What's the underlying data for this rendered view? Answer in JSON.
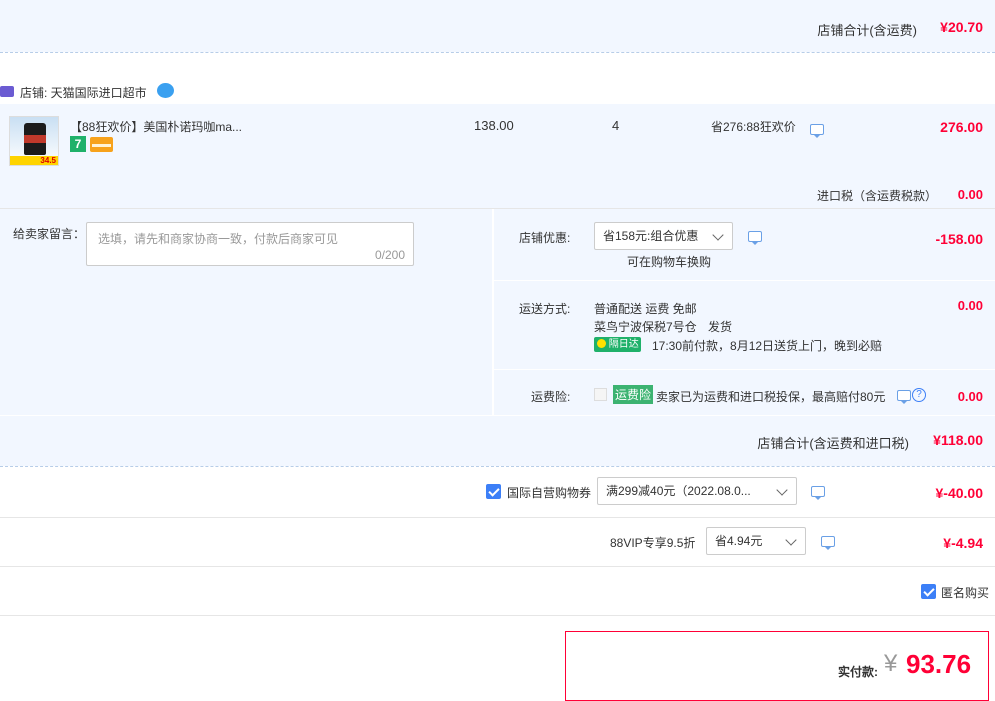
{
  "shop_summary_top": {
    "label": "店铺合计(含运费)",
    "amount": "¥20.70"
  },
  "shop": {
    "label": "店铺: 天猫国际进口超市"
  },
  "item": {
    "title": "【88狂欢价】美国朴诺玛咖ma...",
    "thumb_badge": "34.5",
    "tag1": "7",
    "unit_price": "138.00",
    "quantity": "4",
    "discount": "省276:88狂欢价",
    "subtotal": "276.00"
  },
  "import_tax": {
    "label": "进口税（含运费税款）",
    "amount": "0.00"
  },
  "message": {
    "label": "给卖家留言：",
    "placeholder": "选填，请先和商家协商一致，付款后商家可见",
    "counter": "0/200"
  },
  "shop_discount": {
    "label": "店铺优惠:",
    "selected": "省158元:组合优惠",
    "note": "可在购物车换购",
    "amount": "-158.00"
  },
  "shipping": {
    "label": "运送方式:",
    "method": "普通配送 运费 免邮",
    "warehouse": "菜鸟宁波保税7号仓",
    "ship_status": "发货",
    "badge": "隔日达",
    "eta": "17:30前付款，8月12日送货上门，晚到必赔",
    "amount": "0.00"
  },
  "insurance": {
    "label": "运费险:",
    "tag": "运费险",
    "desc": "卖家已为运费和进口税投保，最高赔付80元",
    "amount": "0.00"
  },
  "shop_total": {
    "label": "店铺合计(含运费和进口税)",
    "amount": "¥118.00"
  },
  "coupon": {
    "label": "国际自营购物券",
    "selected": "满299减40元（2022.08.0...",
    "amount": "¥-40.00"
  },
  "vip": {
    "label": "88VIP专享9.5折",
    "selected": "省4.94元",
    "amount": "¥-4.94"
  },
  "anonymous": {
    "label": "匿名购买"
  },
  "payment": {
    "label": "实付款:",
    "currency": "¥",
    "amount": "93.76"
  },
  "colors": {
    "accent_red": "#ff0036",
    "blue_bg": "#f2f7ff",
    "checkbox_blue": "#3c7ff7",
    "green": "#3cb371"
  }
}
